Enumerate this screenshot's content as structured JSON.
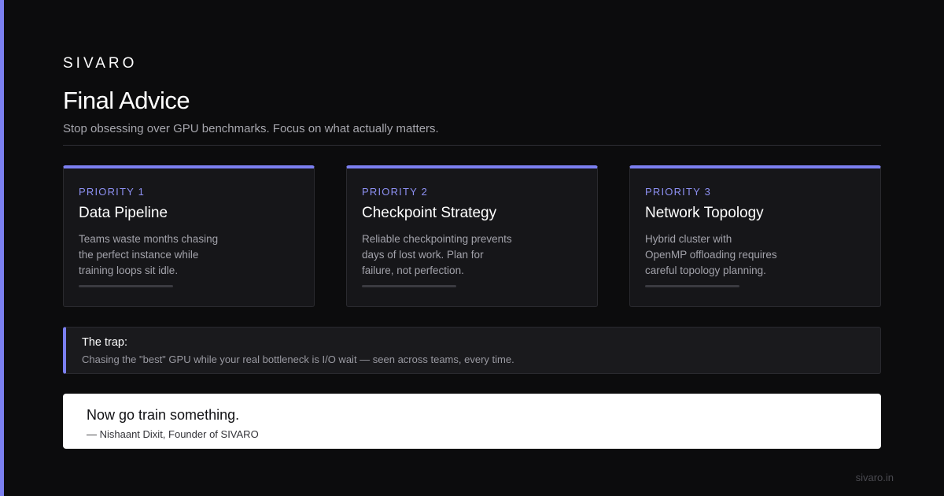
{
  "brand": "SIVARO",
  "title": "Final Advice",
  "subtitle": "Stop obsessing over GPU benchmarks. Focus on what actually matters.",
  "cards": [
    {
      "priority": "PRIORITY 1",
      "title": "Data Pipeline",
      "lines": [
        "Teams waste months chasing",
        "the perfect instance while",
        "training loops sit idle."
      ]
    },
    {
      "priority": "PRIORITY 2",
      "title": "Checkpoint Strategy",
      "lines": [
        "Reliable checkpointing prevents",
        "days of lost work. Plan for",
        "failure, not perfection."
      ]
    },
    {
      "priority": "PRIORITY 3",
      "title": "Network Topology",
      "lines": [
        "Hybrid cluster with",
        "OpenMP offloading requires",
        "careful topology planning."
      ]
    }
  ],
  "trap": {
    "label": "The trap:",
    "text": "Chasing the \"best\" GPU while your real bottleneck is I/O wait — seen across teams, every time."
  },
  "quote": {
    "text": "Now go train something.",
    "author": "— Nishaant Dixit, Founder of SIVARO"
  },
  "footer": "sivaro.in",
  "colors": {
    "accent": "#7b7ff0",
    "background": "#0c0c0d",
    "card": "#161619"
  }
}
